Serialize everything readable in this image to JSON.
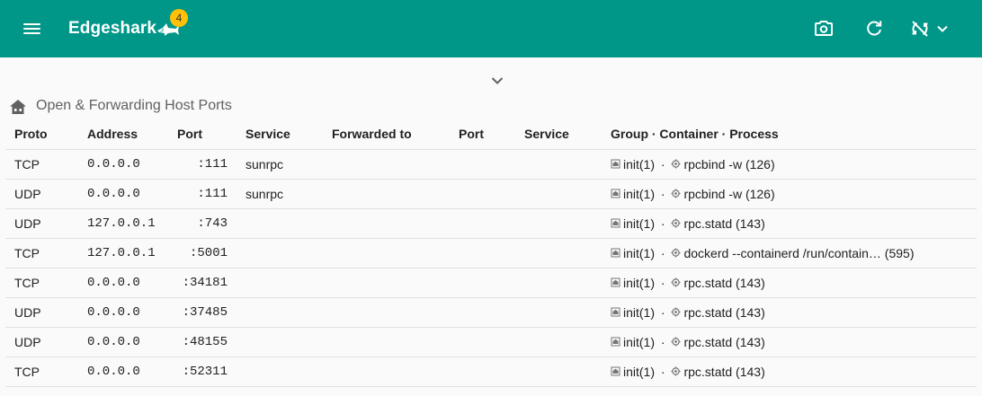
{
  "app": {
    "title": "Edgeshark",
    "badge_count": "4",
    "accent_color": "#009688",
    "badge_color": "#ffc107"
  },
  "toolbar": {
    "icons": [
      "menu-icon",
      "camera-icon",
      "refresh-icon",
      "sync-disabled-icon",
      "chevron-down-icon"
    ]
  },
  "section": {
    "title": "Open & Forwarding Host Ports",
    "icon": "home-network-icon"
  },
  "table": {
    "headers": [
      "Proto",
      "Address",
      "Port",
      "Service",
      "Forwarded to",
      "Port",
      "Service",
      "Group · Container · Process"
    ],
    "rows": [
      {
        "proto": "TCP",
        "address": "0.0.0.0",
        "port": ":111",
        "service": "sunrpc",
        "fwd_to": "",
        "fwd_port": "",
        "fwd_service": "",
        "group": "init(1)",
        "process": "rpcbind -w (126)"
      },
      {
        "proto": "UDP",
        "address": "0.0.0.0",
        "port": ":111",
        "service": "sunrpc",
        "fwd_to": "",
        "fwd_port": "",
        "fwd_service": "",
        "group": "init(1)",
        "process": "rpcbind -w (126)"
      },
      {
        "proto": "UDP",
        "address": "127.0.0.1",
        "port": ":743",
        "service": "",
        "fwd_to": "",
        "fwd_port": "",
        "fwd_service": "",
        "group": "init(1)",
        "process": "rpc.statd (143)"
      },
      {
        "proto": "TCP",
        "address": "127.0.0.1",
        "port": ":5001",
        "service": "",
        "fwd_to": "",
        "fwd_port": "",
        "fwd_service": "",
        "group": "init(1)",
        "process": "dockerd --containerd /run/contain… (595)"
      },
      {
        "proto": "TCP",
        "address": "0.0.0.0",
        "port": ":34181",
        "service": "",
        "fwd_to": "",
        "fwd_port": "",
        "fwd_service": "",
        "group": "init(1)",
        "process": "rpc.statd (143)"
      },
      {
        "proto": "UDP",
        "address": "0.0.0.0",
        "port": ":37485",
        "service": "",
        "fwd_to": "",
        "fwd_port": "",
        "fwd_service": "",
        "group": "init(1)",
        "process": "rpc.statd (143)"
      },
      {
        "proto": "UDP",
        "address": "0.0.0.0",
        "port": ":48155",
        "service": "",
        "fwd_to": "",
        "fwd_port": "",
        "fwd_service": "",
        "group": "init(1)",
        "process": "rpc.statd (143)"
      },
      {
        "proto": "TCP",
        "address": "0.0.0.0",
        "port": ":52311",
        "service": "",
        "fwd_to": "",
        "fwd_port": "",
        "fwd_service": "",
        "group": "init(1)",
        "process": "rpc.statd (143)"
      }
    ]
  }
}
